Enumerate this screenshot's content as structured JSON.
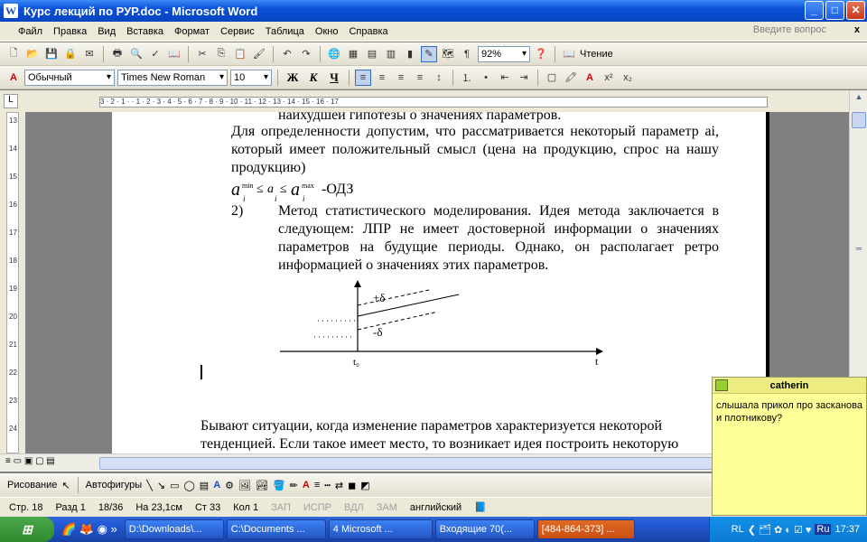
{
  "window": {
    "title": "Курс лекций по РУР.doc - Microsoft Word",
    "app_icon": "W"
  },
  "menu": {
    "items": [
      "Файл",
      "Правка",
      "Вид",
      "Вставка",
      "Формат",
      "Сервис",
      "Таблица",
      "Окно",
      "Справка"
    ],
    "ask_placeholder": "Введите вопрос",
    "close_glyph": "x"
  },
  "toolbar1": {
    "zoom": "92%",
    "reading_label": "Чтение"
  },
  "toolbar2": {
    "style": "Обычный",
    "font": "Times New Roman",
    "size": "10",
    "bold": "Ж",
    "italic": "К",
    "underline": "Ч"
  },
  "ruler": {
    "h_marks": "3 · 2 · 1 · · 1 · 2 · 3 · 4 · 5 · 6 · 7 · 8 · 9 · 10 · 11 · 12 · 13 · 14 · 15 · 16 · 17"
  },
  "ruler_v": {
    "marks": [
      "13",
      "14",
      "15",
      "16",
      "17",
      "18",
      "19",
      "20",
      "21",
      "22",
      "23",
      "24"
    ]
  },
  "document": {
    "line_top": "наихудшей гипотезы о значениях параметров.",
    "para1": "Для определенности допустим, что рассматривается некоторый параметр ai, который имеет положительный смысл (цена на продукцию, спрос на нашу продукцию)",
    "formula_min": "min",
    "formula_max": "max",
    "formula_a": "a",
    "formula_i": "i",
    "formula_leq": "≤",
    "formula_leq2": "≤",
    "formula_odz": "-ОДЗ",
    "item_num": "2)",
    "item_text": "Метод статистического моделирования. Идея метода заключается в следующем: ЛПР не имеет достоверной информации о значениях параметров на будущие периоды. Однако, он располагает ретро информацией о значениях этих параметров.",
    "graph_plus": "+δ",
    "graph_minus": "-δ",
    "graph_t0": "t₀",
    "graph_t": "t",
    "bottom_text": "Бывают ситуации, когда изменение параметров характеризуется некоторой тенденцией. Если такое имеет место, то возникает идея построить некоторую"
  },
  "drawbar": {
    "draw": "Рисование",
    "autoshapes": "Автофигуры"
  },
  "status": {
    "page": "Стр. 18",
    "section": "Разд 1",
    "pages": "18/36",
    "at": "На 23,1см",
    "line": "Ст 33",
    "col": "Кол 1",
    "rec": "ЗАП",
    "trk": "ИСПР",
    "ext": "ВДЛ",
    "ovr": "ЗАМ",
    "lang": "английский"
  },
  "taskbar": {
    "tasks": [
      "D:\\Downloads\\...",
      "C:\\Documents ...",
      "4 Microsoft ...",
      "Входящие 70(...",
      "[484-864-373] ..."
    ],
    "lang": "RL",
    "time": "17:37",
    "tray_lang": "Ru"
  },
  "note": {
    "name": "catherin",
    "message": "слышала прикол про засканова и плотникову?"
  }
}
